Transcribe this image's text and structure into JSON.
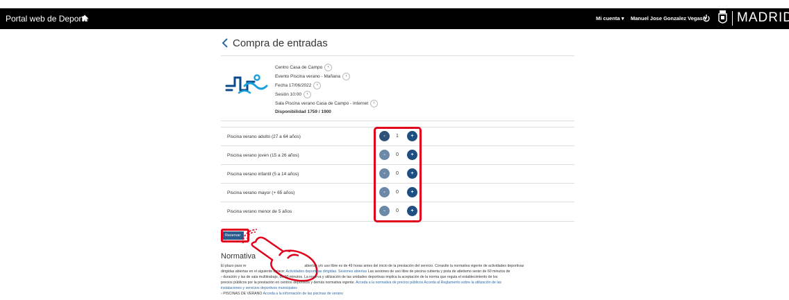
{
  "header": {
    "portal_title": "Portal web de Deporte",
    "my_account": "Mi cuenta",
    "user_name": "Manuel Jose Gonzalez Vegas",
    "city": "MADRID"
  },
  "page": {
    "title": "Compra de entradas"
  },
  "details": {
    "center": "Centro Casa de Campo",
    "event": "Evento Piscina verano - Mañana",
    "date": "Fecha 17/06/2022",
    "session": "Sesión 10:00",
    "room": "Sala Piscina verano Casa de Campo - Internet",
    "availability": "Disponibilidad 1759 / 1900"
  },
  "tickets": [
    {
      "label": "Piscina verano adulto (27 a 64 años)",
      "qty": "1",
      "minus": "-",
      "plus": "+"
    },
    {
      "label": "Piscina verano joven (15 a 26 años)",
      "qty": "0",
      "minus": "-",
      "plus": "+"
    },
    {
      "label": "Piscina verano infantil (5 a 14 años)",
      "qty": "0",
      "minus": "-",
      "plus": "+"
    },
    {
      "label": "Piscina verano mayor (+ 65 años)",
      "qty": "0",
      "minus": "-",
      "plus": "+"
    },
    {
      "label": "Piscina verano menor de 5 años",
      "qty": "0",
      "minus": "-",
      "plus": "+"
    }
  ],
  "reserve_button": "Reservar",
  "normativa": {
    "title": "Normativa",
    "line1_a": "El plazo para re",
    "line1_b": "abiertas y/o uso libre es de 49 horas antes del inicio de la prestación del servicio. Consulte la normativa vigente de actividades deportivas",
    "line2_a": "dirigidas abiertas en el siguiente enlace:",
    "line2_link1": "Actividades deportivas dirigidas. Sesiones abiertas",
    "line2_b": "Las sesiones de uso libre de piscina cubierta y pista de atletismo serán de 60 minutos de",
    "line3": "duración y las de sala multitrabajo, de 90 minutos. La reserva y utilización de las unidades deportivas implica la aceptación de la norma que regula el establecimiento de los",
    "line4_a": "precios públicos por la prestación en centros deportivos y demás normativa vigente.",
    "line4_link": "Acceda a la normativa de precios públicos Acceda al Reglamento sobre la utilización de las",
    "line5_link": "instalaciones y servicios deportivos municipales",
    "line6_a": "PISCINAS DE VERANO",
    "line6_link": "Acceda a la información de las piscinas de verano"
  },
  "colors": {
    "header_bg": "#000000",
    "primary_button": "#1f4e80",
    "highlight": "#e0001b",
    "link": "#2c6aa8"
  }
}
